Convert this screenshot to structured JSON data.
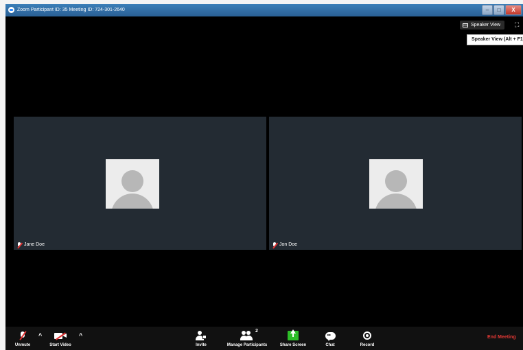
{
  "window": {
    "title": "Zoom Participant ID: 35   Meeting ID: 724-301-2640",
    "minimize_label": "–",
    "maximize_label": "□",
    "close_label": "X"
  },
  "view_controls": {
    "speaker_view_label": "Speaker View",
    "tooltip": "Speaker View (Alt + F1)"
  },
  "participants": [
    {
      "name": "Jane Doe",
      "audio": "muted"
    },
    {
      "name": "Jon Doe",
      "audio": "muted"
    }
  ],
  "toolbar": {
    "unmute_label": "Unmute",
    "audio_options_caret": "^",
    "start_video_label": "Start Video",
    "video_options_caret": "^",
    "invite_label": "Invite",
    "manage_participants_label": "Manage Participants",
    "participant_count": "2",
    "share_screen_label": "Share Screen",
    "chat_label": "Chat",
    "record_label": "Record",
    "end_meeting_label": "End Meeting"
  },
  "colors": {
    "end_meeting": "#e53935",
    "share_screen": "#2dbe28",
    "tile_background": "#232b33"
  }
}
